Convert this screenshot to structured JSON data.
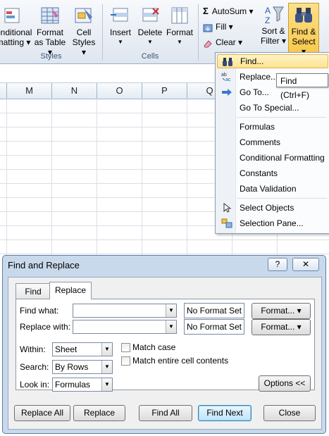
{
  "ribbon": {
    "buttons": {
      "conditional_formatting": [
        "onditional",
        "matting ▾"
      ],
      "format_as_table": [
        "Format",
        "as Table ▾"
      ],
      "cell_styles": [
        "Cell",
        "Styles ▾"
      ],
      "insert": "Insert",
      "delete": "Delete",
      "format": "Format",
      "sort_filter": [
        "Sort &",
        "Filter ▾"
      ],
      "find_select": [
        "Find &",
        "Select ▾"
      ]
    },
    "small": {
      "autosum": "AutoSum ▾",
      "fill": "Fill ▾",
      "clear": "Clear ▾"
    },
    "groups": {
      "styles": "Styles",
      "cells": "Cells"
    }
  },
  "grid": {
    "columns": [
      "M",
      "N",
      "O",
      "P",
      "Q"
    ]
  },
  "menu": {
    "items": [
      {
        "label": "Find...",
        "icon": "binoculars-icon"
      },
      {
        "label": "Replace...",
        "icon": "replace-icon"
      },
      {
        "label": "Go To...",
        "icon": "goto-arrow-icon"
      },
      {
        "label": "Go To Special...",
        "icon": ""
      },
      {
        "label": "Formulas",
        "icon": ""
      },
      {
        "label": "Comments",
        "icon": ""
      },
      {
        "label": "Conditional Formatting",
        "icon": ""
      },
      {
        "label": "Constants",
        "icon": ""
      },
      {
        "label": "Data Validation",
        "icon": ""
      },
      {
        "label": "Select Objects",
        "icon": "pointer-icon"
      },
      {
        "label": "Selection Pane...",
        "icon": "selection-pane-icon"
      }
    ],
    "tooltip": "Find (Ctrl+F)"
  },
  "dialog": {
    "title": "Find and Replace",
    "help": "?",
    "close": "✕",
    "tabs": [
      "Find",
      "Replace"
    ],
    "find_what_label": "Find what:",
    "replace_with_label": "Replace with:",
    "find_what_value": "",
    "replace_with_value": "",
    "no_format_1": "No Format Set",
    "no_format_2": "No Format Set",
    "format_button_1": "Format... ▾",
    "format_button_2": "Format... ▾",
    "within_label": "Within:",
    "within_value": "Sheet",
    "search_label": "Search:",
    "search_value": "By Rows",
    "lookin_label": "Look in:",
    "lookin_value": "Formulas",
    "match_case": "Match case",
    "match_entire": "Match entire cell contents",
    "options_button": "Options <<",
    "buttons": {
      "replace_all": "Replace All",
      "replace": "Replace",
      "find_all": "Find All",
      "find_next": "Find Next",
      "close": "Close"
    }
  }
}
